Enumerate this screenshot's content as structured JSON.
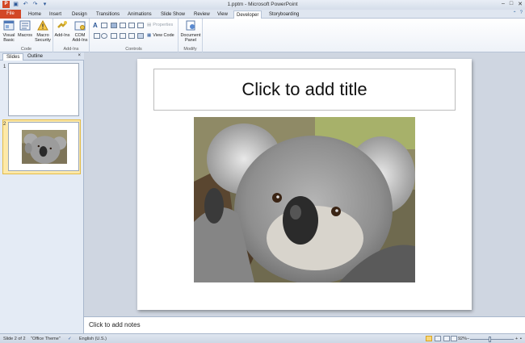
{
  "window": {
    "title": "1.pptm - Microsoft PowerPoint"
  },
  "tabs": [
    {
      "label": "File"
    },
    {
      "label": "Home"
    },
    {
      "label": "Insert"
    },
    {
      "label": "Design"
    },
    {
      "label": "Transitions"
    },
    {
      "label": "Animations"
    },
    {
      "label": "Slide Show"
    },
    {
      "label": "Review"
    },
    {
      "label": "View"
    },
    {
      "label": "Developer"
    },
    {
      "label": "Storyboarding"
    }
  ],
  "active_tab": "Developer",
  "ribbon": {
    "code": {
      "label": "Code",
      "visual_basic": "Visual Basic",
      "macros": "Macros",
      "macro_security": "Macro Security"
    },
    "addins": {
      "label": "Add-Ins",
      "addins": "Add-Ins",
      "com_addins": "COM Add-Ins"
    },
    "controls": {
      "label": "Controls",
      "properties": "Properties",
      "view_code": "View Code"
    },
    "modify": {
      "label": "Modify",
      "document_panel": "Document Panel"
    }
  },
  "left_pane": {
    "tab_slides": "Slides",
    "tab_outline": "Outline",
    "close": "×",
    "slide1_num": "1",
    "slide2_num": "2"
  },
  "slide": {
    "title_placeholder": "Click to add title"
  },
  "notes": {
    "placeholder": "Click to add notes"
  },
  "status": {
    "slide_indicator": "Slide 2 of 2",
    "theme": "\"Office Theme\"",
    "language": "English (U.S.)",
    "zoom": "92%",
    "zoom_level": 0.92
  },
  "colors": {
    "file_tab": "#d24726",
    "selected_thumb": "#fde9a9"
  }
}
